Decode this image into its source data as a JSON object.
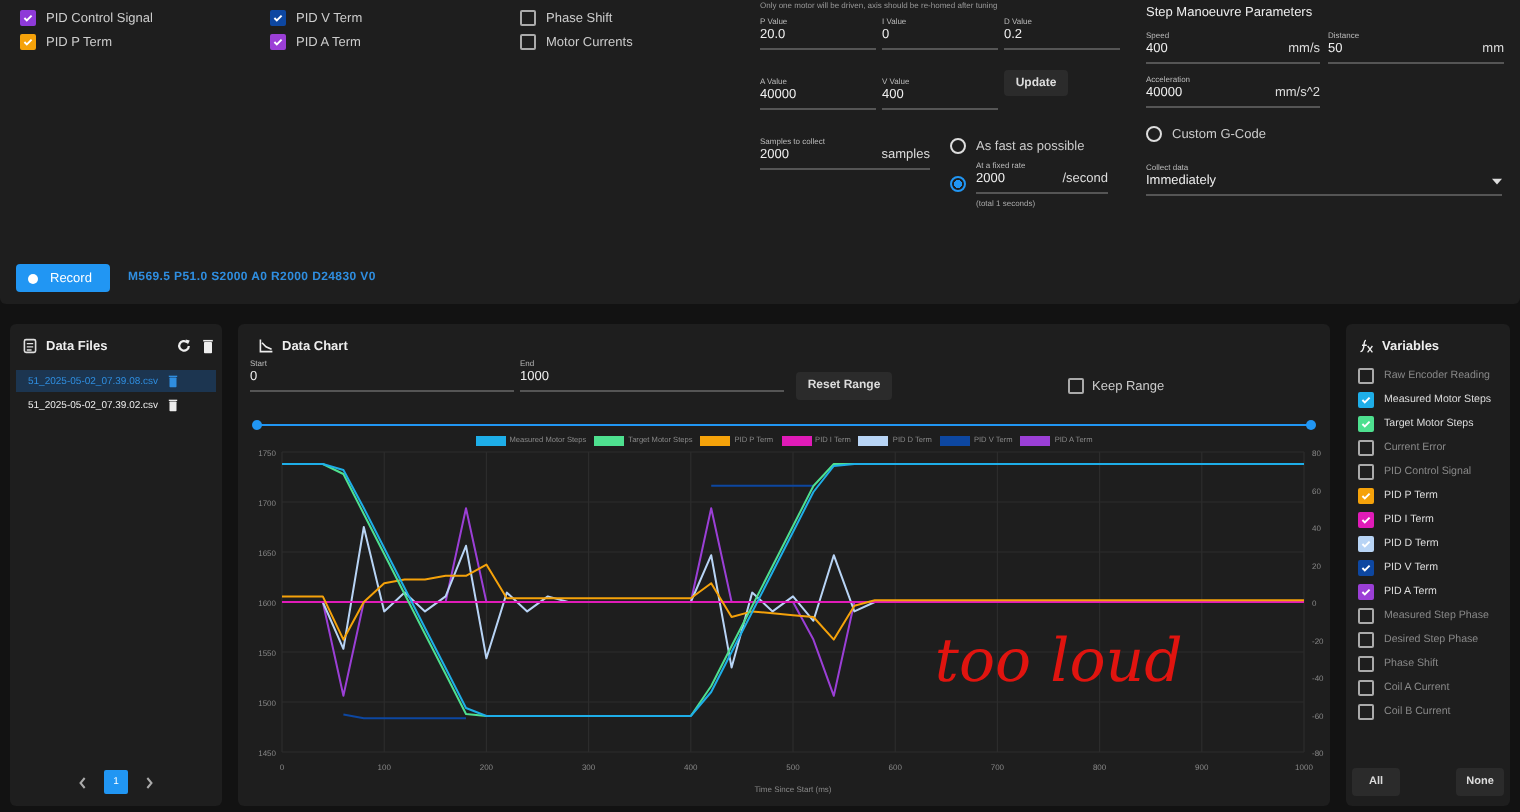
{
  "plot_checkboxes": [
    {
      "label": "PID Control Signal",
      "checked": true,
      "color": "#8e3ad8"
    },
    {
      "label": "PID V Term",
      "checked": true,
      "color": "#0d47a1"
    },
    {
      "label": "Phase Shift",
      "checked": false
    },
    {
      "label": "PID P Term",
      "checked": true,
      "color": "#f5a20a"
    },
    {
      "label": "PID A Term",
      "checked": true,
      "color": "#9b3fd6"
    },
    {
      "label": "Motor Currents",
      "checked": false
    }
  ],
  "record_button": "Record",
  "command": "M569.5 P51.0 S2000 A0 R2000 D24830 V0",
  "tuning": {
    "hint": "Only one motor will be driven, axis should be re-homed after tuning",
    "fields": [
      {
        "label": "P Value",
        "value": "20.0"
      },
      {
        "label": "I Value",
        "value": "0"
      },
      {
        "label": "D Value",
        "value": "0.2"
      },
      {
        "label": "A Value",
        "value": "40000"
      },
      {
        "label": "V Value",
        "value": "400"
      }
    ],
    "update_button": "Update",
    "samples": {
      "label": "Samples to collect",
      "value": "2000",
      "suffix": "samples"
    },
    "rate_options": [
      {
        "kind": "plain",
        "label": "As fast as possible",
        "selected": false
      },
      {
        "kind": "field",
        "label": "At a fixed rate",
        "value": "2000",
        "suffix": "/second",
        "note": "(total 1 seconds)",
        "selected": true
      }
    ]
  },
  "manoeuvre": {
    "title": "Step Manoeuvre Parameters",
    "speed": {
      "label": "Speed",
      "value": "400",
      "suffix": "mm/s"
    },
    "distance": {
      "label": "Distance",
      "value": "50",
      "suffix": "mm"
    },
    "acceleration": {
      "label": "Acceleration",
      "value": "40000",
      "suffix": "mm/s^2"
    },
    "custom_gcode": {
      "label": "Custom G-Code",
      "selected": false
    },
    "collect_data": {
      "label": "Collect data",
      "value": "Immediately"
    }
  },
  "data_files": {
    "title": "Data Files",
    "files": [
      {
        "name": "51_2025-05-02_07.39.08.csv",
        "selected": true
      },
      {
        "name": "51_2025-05-02_07.39.02.csv",
        "selected": false
      }
    ],
    "pages": [
      {
        "label": "1",
        "selected": true
      }
    ]
  },
  "data_chart": {
    "title": "Data Chart",
    "start": {
      "label": "Start",
      "value": "0"
    },
    "end": {
      "label": "End",
      "value": "1000"
    },
    "reset_button": "Reset Range",
    "keep_range": {
      "label": "Keep Range",
      "checked": false
    },
    "range_thumbs": [
      {
        "level": 0
      },
      {
        "level": 1
      }
    ],
    "chart_data": {
      "type": "line",
      "xlabel": "Time Since Start (ms)",
      "x": [
        0,
        20,
        40,
        60,
        80,
        100,
        120,
        140,
        160,
        180,
        200,
        220,
        240,
        260,
        280,
        300,
        320,
        340,
        360,
        380,
        400,
        420,
        440,
        460,
        480,
        500,
        520,
        540,
        560,
        580,
        600,
        620,
        640,
        660,
        680,
        700,
        720,
        740,
        760,
        780,
        800,
        820,
        840,
        860,
        880,
        900,
        920,
        940,
        960,
        980,
        1000
      ],
      "xlim": [
        0,
        1000
      ],
      "ylim": [
        1450,
        1750
      ],
      "y2lim": [
        -80,
        80
      ],
      "xticks": [
        0,
        100,
        200,
        300,
        400,
        500,
        600,
        700,
        800,
        900,
        1000
      ],
      "yticks": [
        1450,
        1500,
        1550,
        1600,
        1650,
        1700,
        1750
      ],
      "y2ticks": [
        -80,
        -60,
        -40,
        -20,
        0,
        20,
        40,
        60,
        80
      ],
      "series": [
        {
          "name": "Measured Motor Steps",
          "color": "#1eaee8",
          "values": [
            1738,
            1738,
            1738,
            1732,
            1694,
            1654,
            1614,
            1574,
            1534,
            1494,
            1486,
            1486,
            1486,
            1486,
            1486,
            1486,
            1486,
            1486,
            1486,
            1486,
            1486,
            1510,
            1550,
            1590,
            1630,
            1670,
            1710,
            1736,
            1738,
            1738,
            1738,
            1738,
            1738,
            1738,
            1738,
            1738,
            1738,
            1738,
            1738,
            1738,
            1738,
            1738,
            1738,
            1738,
            1738,
            1738,
            1738,
            1738,
            1738,
            1738,
            1738
          ]
        },
        {
          "name": "Target Motor Steps",
          "color": "#4ee08f",
          "values": [
            null,
            null,
            1738,
            1728,
            1688,
            1648,
            1608,
            1568,
            1528,
            1488,
            1486,
            null,
            null,
            null,
            null,
            null,
            null,
            null,
            null,
            null,
            1486,
            1516,
            1556,
            1596,
            1636,
            1676,
            1716,
            1738,
            1738,
            null,
            null,
            null,
            null,
            null,
            null,
            null,
            null,
            null,
            null,
            null,
            null,
            null,
            null,
            null,
            null,
            null,
            null,
            null,
            null,
            null,
            null
          ]
        },
        {
          "name": "PID P Term",
          "color": "#f5a20a",
          "axis": "y2",
          "values": [
            3,
            3,
            3,
            -20,
            0,
            10,
            12,
            12,
            14,
            14,
            20,
            2,
            2,
            2,
            2,
            2,
            2,
            2,
            2,
            2,
            2,
            10,
            -8,
            -5,
            -6,
            -7,
            -8,
            -20,
            -2,
            1,
            1,
            1,
            1,
            1,
            1,
            1,
            1,
            1,
            1,
            1,
            1,
            1,
            1,
            1,
            1,
            1,
            1,
            1,
            1,
            1,
            1
          ]
        },
        {
          "name": "PID I Term",
          "color": "#e01bb8",
          "axis": "y2",
          "values": [
            0,
            0,
            0,
            0,
            0,
            0,
            0,
            0,
            0,
            0,
            0,
            0,
            0,
            0,
            0,
            0,
            0,
            0,
            0,
            0,
            0,
            0,
            0,
            0,
            0,
            0,
            0,
            0,
            0,
            0,
            0,
            0,
            0,
            0,
            0,
            0,
            0,
            0,
            0,
            0,
            0,
            0,
            0,
            0,
            0,
            0,
            0,
            0,
            0,
            0,
            0
          ]
        },
        {
          "name": "PID D Term",
          "color": "#b8d4f5",
          "axis": "y2",
          "values": [
            null,
            null,
            0,
            -25,
            40,
            -5,
            5,
            -5,
            3,
            30,
            -30,
            5,
            -5,
            3,
            0,
            null,
            null,
            null,
            null,
            null,
            0,
            25,
            -35,
            5,
            -5,
            3,
            -10,
            25,
            -5,
            0,
            null,
            null,
            null,
            null,
            null,
            null,
            null,
            null,
            null,
            null,
            null,
            null,
            null,
            null,
            null,
            null,
            null,
            null,
            null,
            null,
            null
          ]
        },
        {
          "name": "PID V Term",
          "color": "#0d47a1",
          "axis": "y2",
          "values": [
            null,
            null,
            null,
            -60,
            -62,
            -62,
            -62,
            -62,
            -62,
            -62,
            null,
            null,
            null,
            null,
            null,
            null,
            null,
            null,
            null,
            null,
            null,
            62,
            62,
            62,
            62,
            62,
            62,
            null,
            null,
            null,
            null,
            null,
            null,
            null,
            null,
            null,
            null,
            null,
            null,
            null,
            null,
            null,
            null,
            null,
            null,
            null,
            null,
            null,
            null,
            null,
            null
          ]
        },
        {
          "name": "PID A Term",
          "color": "#9b3fd6",
          "axis": "y2",
          "values": [
            null,
            null,
            0,
            -50,
            0,
            null,
            null,
            null,
            0,
            50,
            0,
            null,
            null,
            null,
            null,
            null,
            null,
            null,
            null,
            null,
            0,
            50,
            0,
            null,
            null,
            0,
            -20,
            -50,
            0,
            null,
            null,
            null,
            null,
            null,
            null,
            null,
            null,
            null,
            null,
            null,
            null,
            null,
            null,
            null,
            null,
            null,
            null,
            null,
            null,
            null,
            null
          ]
        }
      ],
      "grid": true,
      "annotations": [
        "too loud"
      ]
    }
  },
  "variables": {
    "title": "Variables",
    "items": [
      {
        "label": "Raw Encoder Reading",
        "checked": false
      },
      {
        "label": "Measured Motor Steps",
        "checked": true,
        "color": "#1eaee8"
      },
      {
        "label": "Target Motor Steps",
        "checked": true,
        "color": "#4ee08f"
      },
      {
        "label": "Current Error",
        "checked": false
      },
      {
        "label": "PID Control Signal",
        "checked": false
      },
      {
        "label": "PID P Term",
        "checked": true,
        "color": "#f5a20a"
      },
      {
        "label": "PID I Term",
        "checked": true,
        "color": "#e01bb8"
      },
      {
        "label": "PID D Term",
        "checked": true,
        "color": "#b8d4f5"
      },
      {
        "label": "PID V Term",
        "checked": true,
        "color": "#0d47a1"
      },
      {
        "label": "PID A Term",
        "checked": true,
        "color": "#9b3fd6"
      },
      {
        "label": "Measured Step Phase",
        "checked": false
      },
      {
        "label": "Desired Step Phase",
        "checked": false
      },
      {
        "label": "Phase Shift",
        "checked": false
      },
      {
        "label": "Coil A Current",
        "checked": false
      },
      {
        "label": "Coil B Current",
        "checked": false
      }
    ],
    "all_button": "All",
    "none_button": "None"
  }
}
